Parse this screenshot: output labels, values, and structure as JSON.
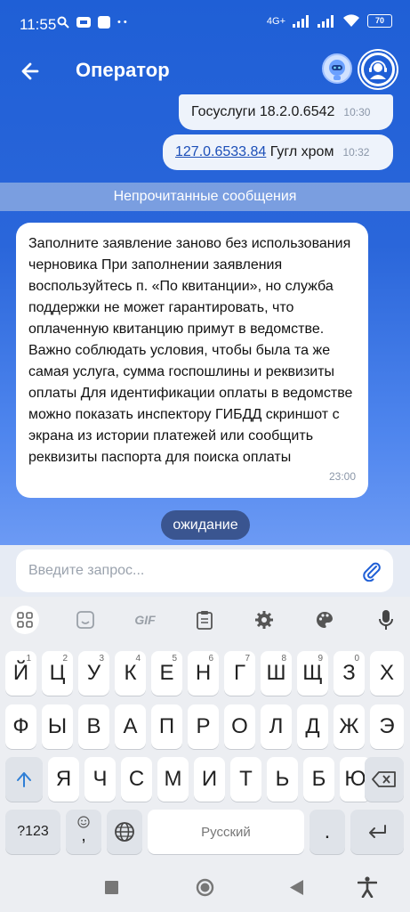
{
  "status_bar": {
    "time": "11:55",
    "network": "4G+",
    "battery": "70"
  },
  "app_bar": {
    "title": "Оператор"
  },
  "messages_out": [
    {
      "text": "Госуслуги 18.2.0.6542",
      "time": "10:30"
    },
    {
      "link": "127.0.6533.84",
      "text": "Гугл хром",
      "time": "10:32"
    }
  ],
  "unread_label": "Непрочитанные сообщения",
  "message_in": {
    "text": "Заполните заявление заново без использования черновика При заполнении заявления воспользуйтесь п. «По квитанции», но служба поддержки не может гарантировать, что оплаченную квитанцию примут в ведомстве. Важно соблюдать условия, чтобы была та же самая услуга, сумма госпошлины и реквизиты оплаты Для идентификации оплаты в ведомстве можно показать инспектору ГИБДД скриншот с экрана из истории платежей или сообщить реквизиты паспорта для поиска оплаты",
    "time": "23:00"
  },
  "status_pill": "ожидание",
  "input": {
    "placeholder": "Введите запрос..."
  },
  "keyboard": {
    "toolbar": {
      "gif": "GIF"
    },
    "row1": [
      "Й",
      "Ц",
      "У",
      "К",
      "Е",
      "Н",
      "Г",
      "Ш",
      "Щ",
      "З",
      "Х"
    ],
    "row1_hints": [
      "1",
      "2",
      "3",
      "4",
      "5",
      "6",
      "7",
      "8",
      "9",
      "0",
      ""
    ],
    "row2": [
      "Ф",
      "Ы",
      "В",
      "А",
      "П",
      "Р",
      "О",
      "Л",
      "Д",
      "Ж",
      "Э"
    ],
    "row3": [
      "Я",
      "Ч",
      "С",
      "М",
      "И",
      "Т",
      "Ь",
      "Б",
      "Ю"
    ],
    "symbols_key": "?123",
    "comma_key": ",",
    "space_label": "Русский",
    "period_key": "."
  },
  "colors": {
    "header_blue": "#1f5fd6",
    "pill_bg": "#3a5590",
    "shift_blue": "#2f7fd6"
  }
}
